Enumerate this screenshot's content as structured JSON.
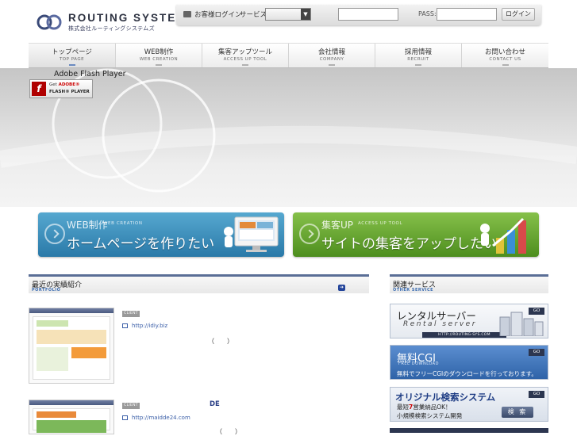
{
  "header": {
    "logo_title": "ROUTING SYSTEMS",
    "logo_subtitle": "株式会社ルーティングシステムズ",
    "login_label": "お客様ログイン",
    "service_label": "サービス：",
    "service_selected": "",
    "id_value": "",
    "pass_label": "PASS:",
    "pass_value": "",
    "login_button": "ログイン"
  },
  "nav": [
    {
      "jp": "トップページ",
      "en": "TOP PAGE"
    },
    {
      "jp": "WEB制作",
      "en": "WEB CREATION"
    },
    {
      "jp": "集客アップツール",
      "en": "ACCESS UP TOOL"
    },
    {
      "jp": "会社情報",
      "en": "COMPANY"
    },
    {
      "jp": "採用情報",
      "en": "RECRUIT"
    },
    {
      "jp": "お問い合わせ",
      "en": "CONTACT US"
    }
  ],
  "hero": {
    "flash_label": "Adobe Flash Player",
    "flash_get": "Get",
    "flash_adobe": "ADOBE®",
    "flash_player": "FLASH® PLAYER"
  },
  "banners": {
    "web": {
      "category": "WEB制作",
      "category_en": "WEB CREATION",
      "headline": "ホームページを作りたい"
    },
    "seo": {
      "category": "集客UP",
      "category_en": "ACCESS UP TOOL",
      "headline": "サイトの集客をアップしたい"
    }
  },
  "portfolio": {
    "title": "最近の実績紹介",
    "title_en": "PORTFOLIO",
    "items": [
      {
        "badge": "CLIENT",
        "url": "http://idiy.biz",
        "paren": "（　　）"
      },
      {
        "badge": "CLIENT",
        "url": "http://maidde24.com",
        "paren": "（　　）",
        "extra": "DE"
      }
    ]
  },
  "other_services": {
    "title": "関連サービス",
    "title_en": "OTHER SERVICE",
    "rental": {
      "title": "レンタルサーバー",
      "subtitle": "Rental server",
      "url": "HTTP://ROUTING-SYS.COM",
      "go": "GO"
    },
    "cgi": {
      "title": "無料CGI",
      "subtitle": "FREE DOWNLOAD",
      "desc": "無料でフリーCGIのダウンロードを行っております。",
      "go": "GO"
    },
    "search": {
      "title": "オリジナル検索システム",
      "line1_pre": "最短",
      "line1_num": "7",
      "line1_post": "営業納品OK！",
      "line2": "小規模検索システム開発",
      "button": "検 索",
      "go": "GO"
    }
  },
  "colors": {
    "nav_active": "#6a8ac0",
    "section_border": "#5a6e96",
    "web_banner": "#2a79a8",
    "seo_banner": "#4d8e1e",
    "cgi_banner": "#2f63a8"
  }
}
